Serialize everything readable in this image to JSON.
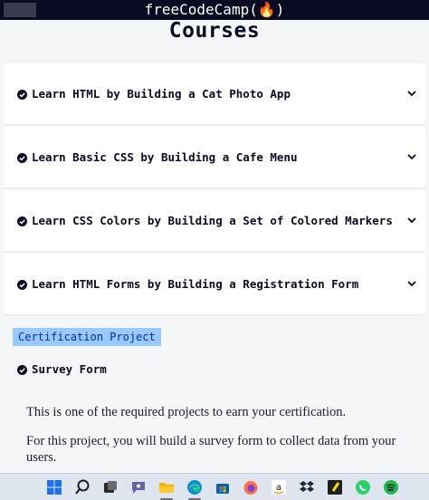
{
  "topbar": {
    "brand": "freeCodeCamp(🔥)"
  },
  "page": {
    "heading": "Courses"
  },
  "courses": [
    {
      "label": "Learn HTML by Building a Cat Photo App"
    },
    {
      "label": "Learn Basic CSS by Building a Cafe Menu"
    },
    {
      "label": "Learn CSS Colors by Building a Set of Colored Markers"
    },
    {
      "label": "Learn HTML Forms by Building a Registration Form"
    }
  ],
  "certification": {
    "badge": "Certification Project",
    "project_title": "Survey Form",
    "description_1": "This is one of the required projects to earn your certification.",
    "description_2": "For this project, you will build a survey form to collect data from your users."
  },
  "taskbar": {
    "icons": [
      "windows-start",
      "search",
      "task-view",
      "teams-chat",
      "file-explorer",
      "edge",
      "store",
      "firefox",
      "amazon",
      "dropbox",
      "sticky-notes",
      "whatsapp",
      "spotify"
    ]
  },
  "colors": {
    "topbar": "#0a0a23",
    "badge_bg": "#99c9ff",
    "badge_text": "#002ead",
    "taskbar": "#dfe5ee"
  }
}
